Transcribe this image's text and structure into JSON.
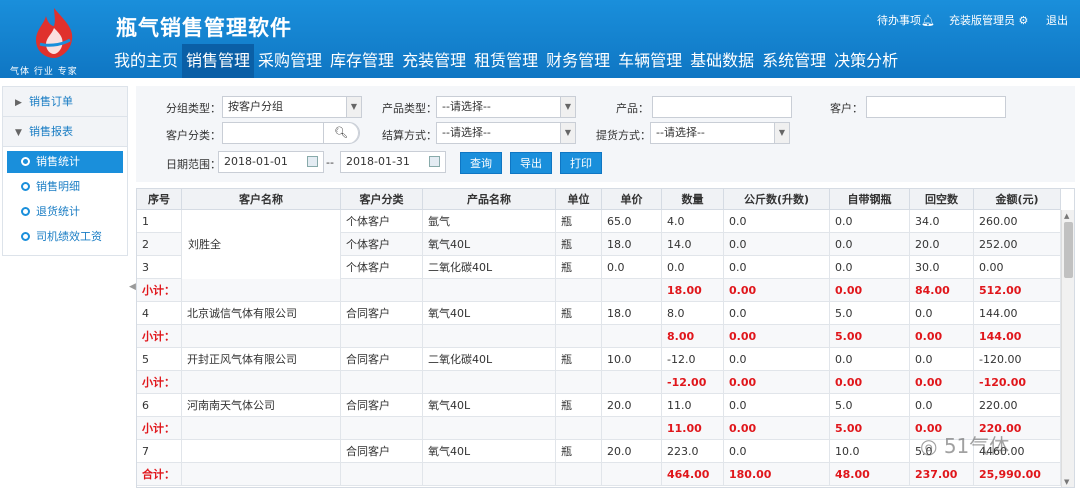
{
  "header": {
    "title": "瓶气销售管理软件",
    "slogan": "气体 行业 专家",
    "pending": "待办事项",
    "user": "充装版管理员",
    "logout": "退出"
  },
  "nav": [
    {
      "label": "我的主页"
    },
    {
      "label": "销售管理"
    },
    {
      "label": "采购管理"
    },
    {
      "label": "库存管理"
    },
    {
      "label": "充装管理"
    },
    {
      "label": "租赁管理"
    },
    {
      "label": "财务管理"
    },
    {
      "label": "车辆管理"
    },
    {
      "label": "基础数据"
    },
    {
      "label": "系统管理"
    },
    {
      "label": "决策分析"
    }
  ],
  "sidebar": {
    "group1": "销售订单",
    "group2": "销售报表",
    "items": [
      {
        "label": "销售统计"
      },
      {
        "label": "销售明细"
      },
      {
        "label": "退货统计"
      },
      {
        "label": "司机绩效工资"
      }
    ]
  },
  "filters": {
    "group_type_label": "分组类型：",
    "group_type_value": "按客户分组",
    "product_type_label": "产品类型：",
    "product_type_value": "--请选择--",
    "product_label": "产品：",
    "customer_label": "客户：",
    "customer_category_label": "客户分类：",
    "settlement_label": "结算方式：",
    "settlement_value": "--请选择--",
    "pickup_label": "提货方式：",
    "pickup_value": "--请选择--",
    "date_range_label": "日期范围：",
    "date_from": "2018-01-01",
    "date_sep": "--",
    "date_to": "2018-01-31",
    "query_btn": "查询",
    "export_btn": "导出",
    "print_btn": "打印"
  },
  "table": {
    "headers": [
      "序号",
      "客户名称",
      "客户分类",
      "产品名称",
      "单位",
      "单价",
      "数量",
      "公斤数(升数)",
      "自带钢瓶",
      "回空数",
      "金额(元)"
    ],
    "rows": [
      {
        "kind": "data",
        "cells": [
          "1",
          "",
          "个体客户",
          "氩气",
          "瓶",
          "65.0",
          "4.0",
          "0.0",
          "0.0",
          "34.0",
          "260.00"
        ]
      },
      {
        "kind": "data",
        "cells": [
          "2",
          "",
          "个体客户",
          "氧气40L",
          "瓶",
          "18.0",
          "14.0",
          "0.0",
          "0.0",
          "20.0",
          "252.00"
        ]
      },
      {
        "kind": "data",
        "cells": [
          "3",
          "",
          "个体客户",
          "二氧化碳40L",
          "瓶",
          "0.0",
          "0.0",
          "0.0",
          "0.0",
          "30.0",
          "0.00"
        ]
      },
      {
        "kind": "sub",
        "cells": [
          "小计：",
          "",
          "",
          "",
          "",
          "",
          "18.00",
          "0.00",
          "0.00",
          "84.00",
          "512.00"
        ]
      },
      {
        "kind": "data",
        "cells": [
          "4",
          "北京诚信气体有限公司",
          "合同客户",
          "氧气40L",
          "瓶",
          "18.0",
          "8.0",
          "0.0",
          "5.0",
          "0.0",
          "144.00"
        ]
      },
      {
        "kind": "sub",
        "cells": [
          "小计：",
          "",
          "",
          "",
          "",
          "",
          "8.00",
          "0.00",
          "5.00",
          "0.00",
          "144.00"
        ]
      },
      {
        "kind": "data",
        "cells": [
          "5",
          "开封正风气体有限公司",
          "合同客户",
          "二氧化碳40L",
          "瓶",
          "10.0",
          "-12.0",
          "0.0",
          "0.0",
          "0.0",
          "-120.00"
        ]
      },
      {
        "kind": "sub",
        "cells": [
          "小计：",
          "",
          "",
          "",
          "",
          "",
          "-12.00",
          "0.00",
          "0.00",
          "0.00",
          "-120.00"
        ]
      },
      {
        "kind": "data",
        "cells": [
          "6",
          "河南南天气体公司",
          "合同客户",
          "氧气40L",
          "瓶",
          "20.0",
          "11.0",
          "0.0",
          "5.0",
          "0.0",
          "220.00"
        ]
      },
      {
        "kind": "sub",
        "cells": [
          "小计：",
          "",
          "",
          "",
          "",
          "",
          "11.00",
          "0.00",
          "5.00",
          "0.00",
          "220.00"
        ]
      },
      {
        "kind": "data",
        "cells": [
          "7",
          "",
          "合同客户",
          "氧气40L",
          "瓶",
          "20.0",
          "223.0",
          "0.0",
          "10.0",
          "5.0",
          "4460.00"
        ]
      },
      {
        "kind": "sub",
        "cells": [
          "合计：",
          "",
          "",
          "",
          "",
          "",
          "464.00",
          "180.00",
          "48.00",
          "237.00",
          "25,990.00"
        ]
      }
    ],
    "merged_customer": "刘胜全"
  },
  "watermark": "51气体"
}
